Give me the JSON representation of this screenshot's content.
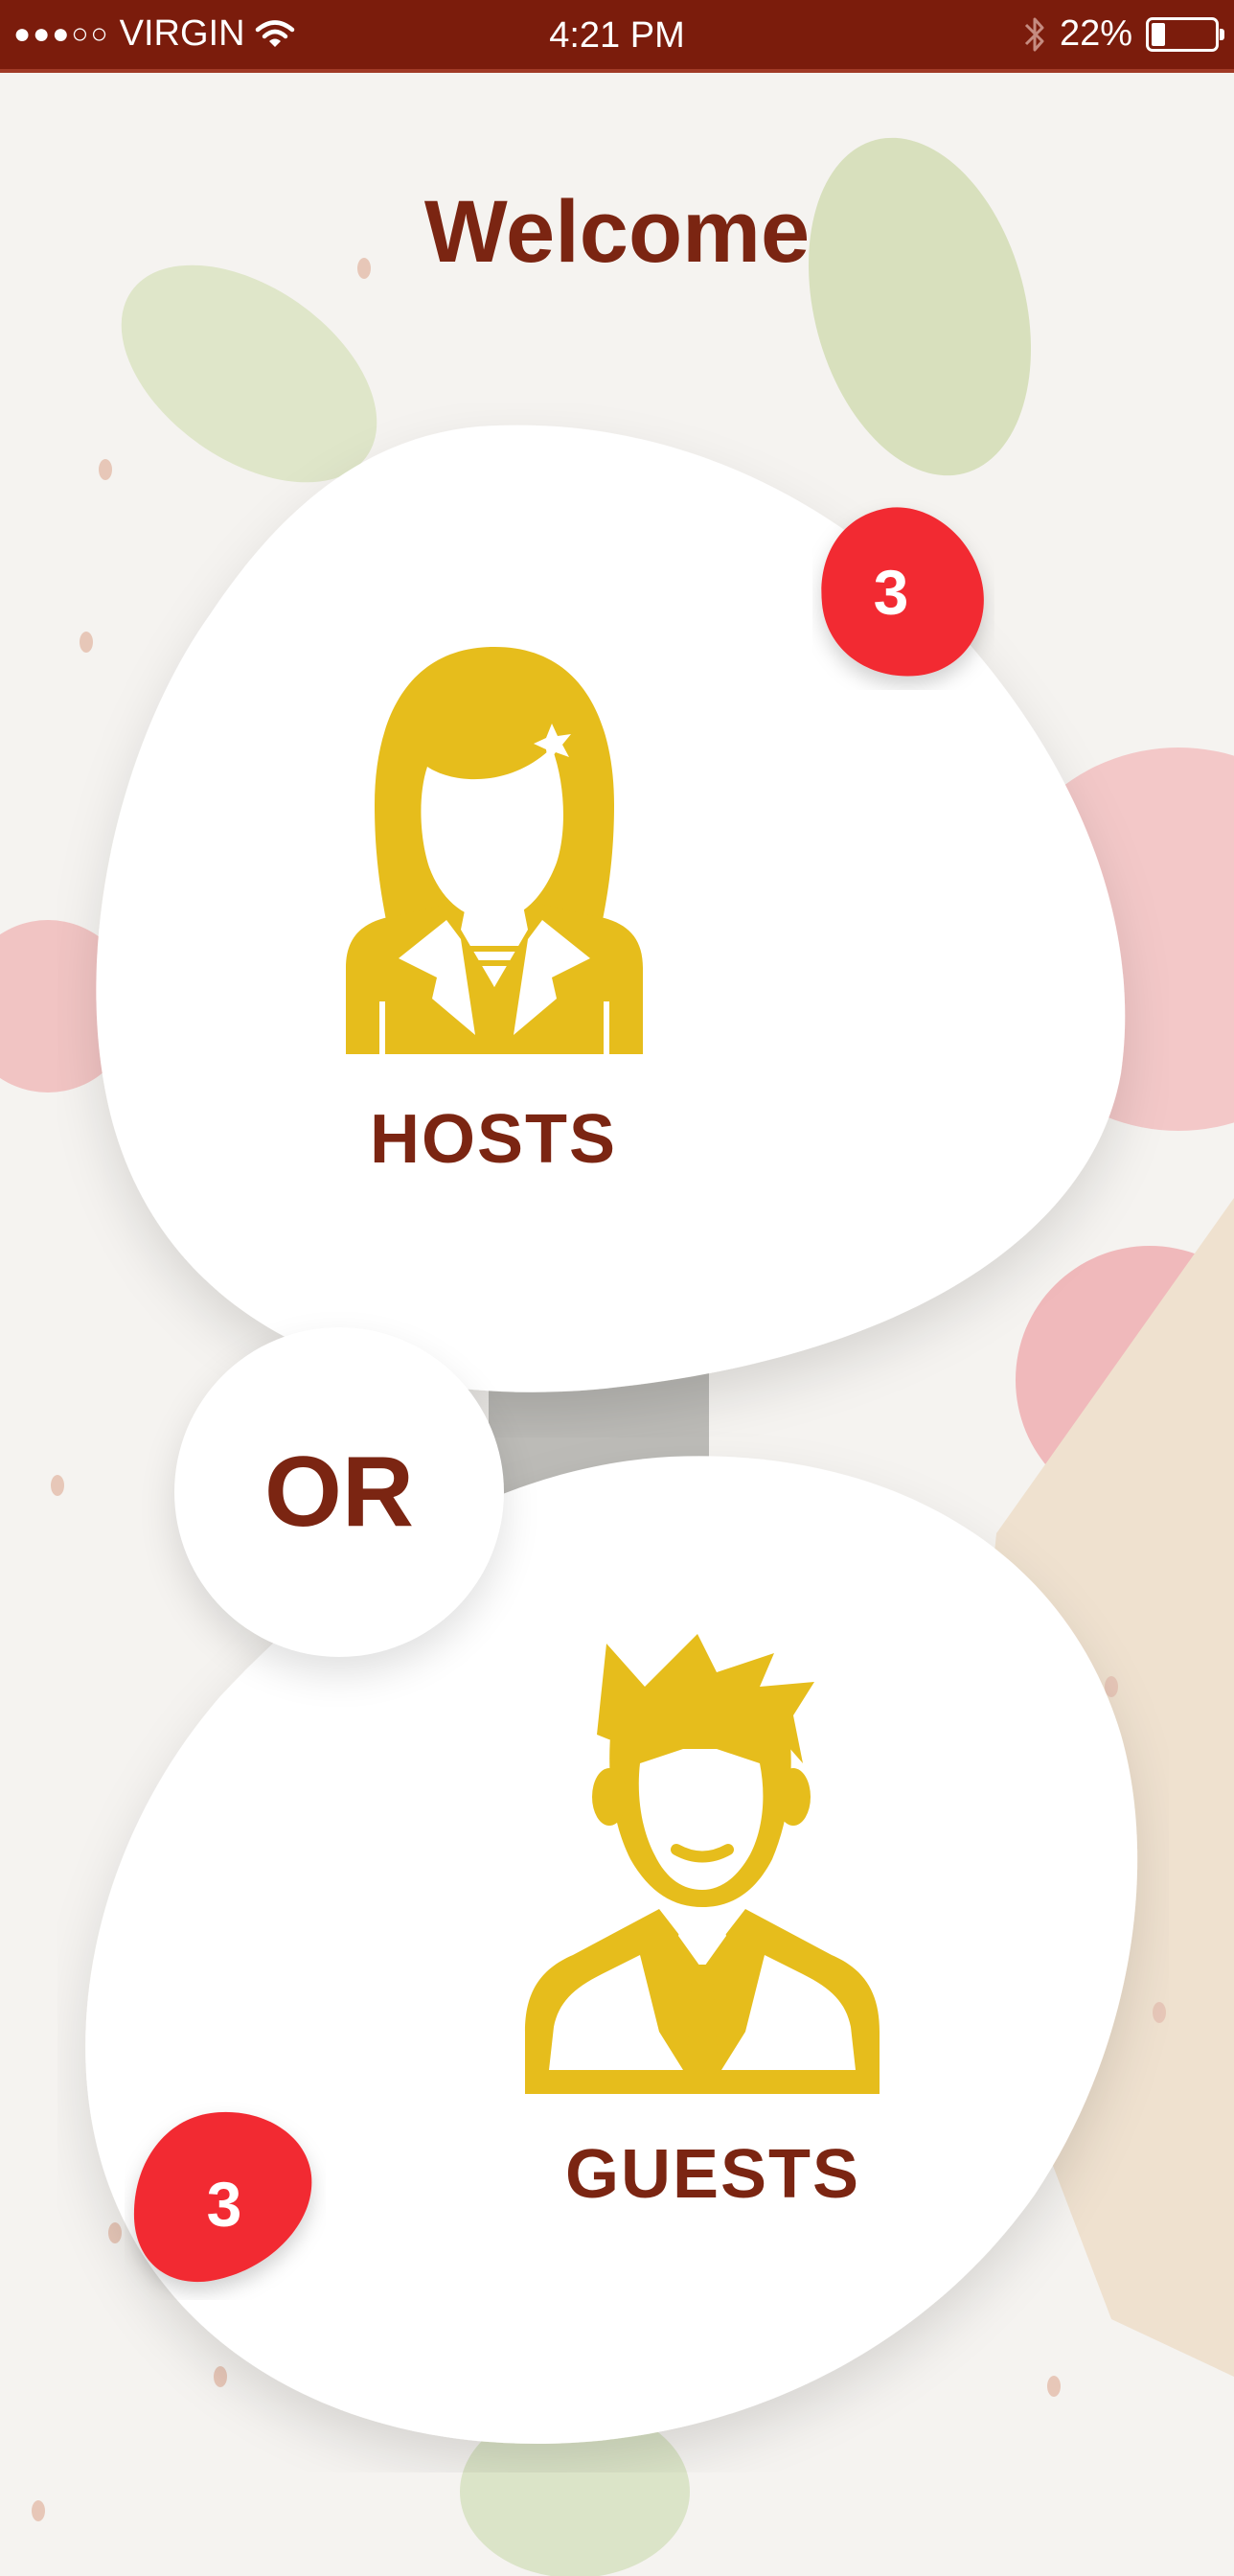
{
  "status_bar": {
    "signal": "●●●○○",
    "carrier": "VIRGIN",
    "time": "4:21 PM",
    "battery_percent": "22%",
    "battery_level": 0.22,
    "icons": [
      "wifi-icon",
      "bluetooth-icon",
      "battery-icon"
    ]
  },
  "title": "Welcome",
  "hosts": {
    "label": "HOSTS",
    "badge": "3",
    "icon": "female-host-avatar-icon"
  },
  "separator": "OR",
  "guests": {
    "label": "GUESTS",
    "badge": "3",
    "icon": "male-guest-avatar-icon"
  },
  "colors": {
    "status_bar": "#7b1c0c",
    "accent_text": "#7b2512",
    "avatar": "#e6bd1c",
    "badge": "#f22b30",
    "card": "#ffffff"
  }
}
